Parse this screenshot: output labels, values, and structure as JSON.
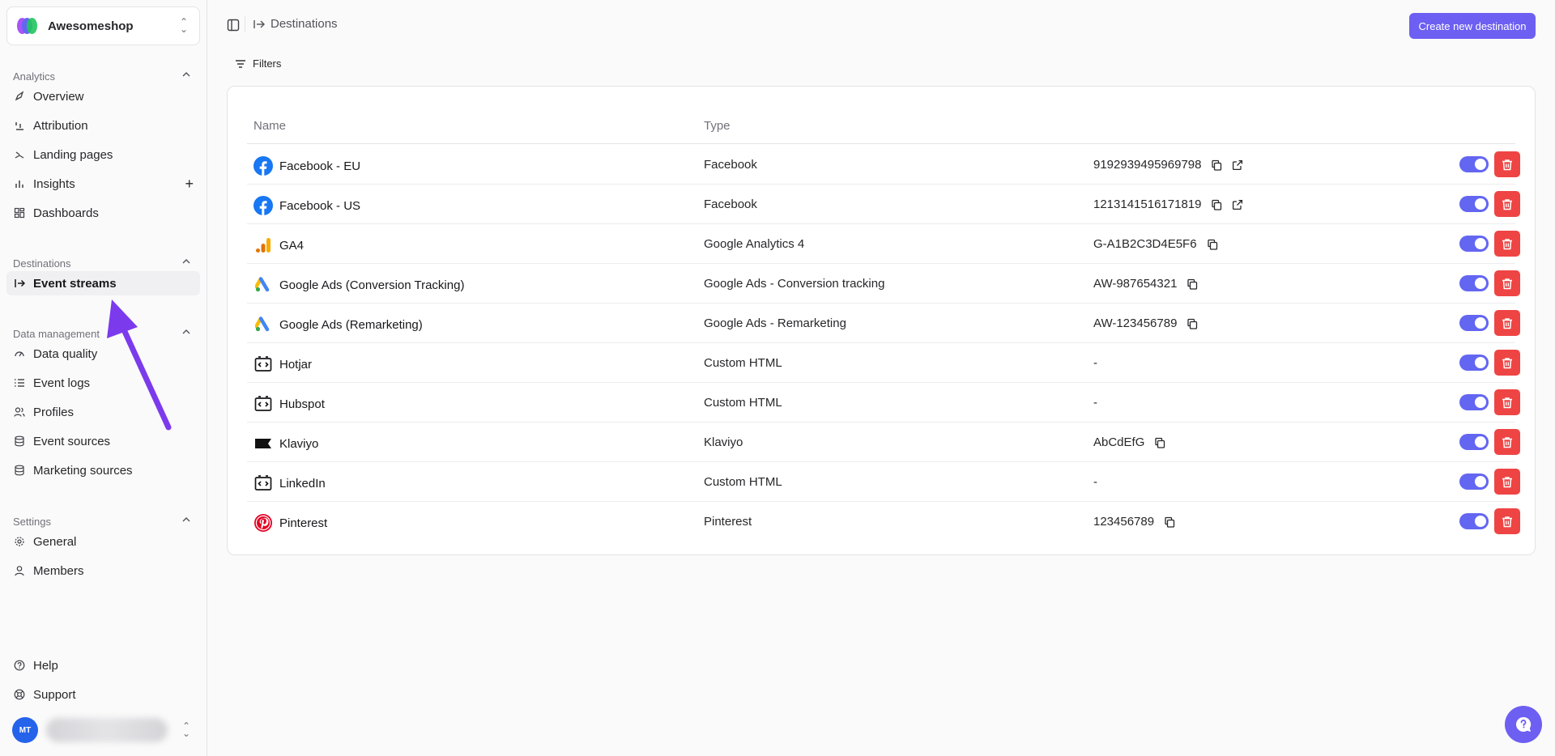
{
  "workspace": {
    "name": "Awesomeshop"
  },
  "sidebar": {
    "sections": [
      {
        "title": "Analytics",
        "items": [
          {
            "label": "Overview",
            "icon": "rocket-icon"
          },
          {
            "label": "Attribution",
            "icon": "attribution-icon"
          },
          {
            "label": "Landing pages",
            "icon": "landing-icon"
          },
          {
            "label": "Insights",
            "icon": "bar-chart-icon"
          },
          {
            "label": "Dashboards",
            "icon": "dashboard-icon"
          }
        ]
      },
      {
        "title": "Destinations",
        "items": [
          {
            "label": "Event streams",
            "icon": "arrow-right-from-line-icon",
            "active": true
          }
        ]
      },
      {
        "title": "Data management",
        "items": [
          {
            "label": "Data quality",
            "icon": "gauge-icon"
          },
          {
            "label": "Event logs",
            "icon": "list-icon"
          },
          {
            "label": "Profiles",
            "icon": "users-icon"
          },
          {
            "label": "Event sources",
            "icon": "database-icon"
          },
          {
            "label": "Marketing sources",
            "icon": "database-icon"
          }
        ]
      },
      {
        "title": "Settings",
        "items": [
          {
            "label": "General",
            "icon": "gear-icon"
          },
          {
            "label": "Members",
            "icon": "user-icon"
          }
        ]
      }
    ],
    "footer": [
      {
        "label": "Help",
        "icon": "help-circle-icon"
      },
      {
        "label": "Support",
        "icon": "life-buoy-icon"
      }
    ],
    "user": {
      "initials": "MT"
    }
  },
  "header": {
    "breadcrumb": "Destinations",
    "create_button": "Create new destination",
    "filters_label": "Filters"
  },
  "table": {
    "columns": [
      "Name",
      "Type"
    ],
    "rows": [
      {
        "name": "Facebook - EU",
        "type": "Facebook",
        "id": "9192939495969798",
        "logo": "facebook",
        "copy": true,
        "external": true,
        "enabled": true
      },
      {
        "name": "Facebook - US",
        "type": "Facebook",
        "id": "1213141516171819",
        "logo": "facebook",
        "copy": true,
        "external": true,
        "enabled": true
      },
      {
        "name": "GA4",
        "type": "Google Analytics 4",
        "id": "G-A1B2C3D4E5F6",
        "logo": "ga4",
        "copy": true,
        "external": false,
        "enabled": true
      },
      {
        "name": "Google Ads (Conversion Tracking)",
        "type": "Google Ads - Conversion tracking",
        "id": "AW-987654321",
        "logo": "google-ads",
        "copy": true,
        "external": false,
        "enabled": true
      },
      {
        "name": "Google Ads (Remarketing)",
        "type": "Google Ads - Remarketing",
        "id": "AW-123456789",
        "logo": "google-ads",
        "copy": true,
        "external": false,
        "enabled": true
      },
      {
        "name": "Hotjar",
        "type": "Custom HTML",
        "id": "-",
        "logo": "custom-html",
        "copy": false,
        "external": false,
        "enabled": true
      },
      {
        "name": "Hubspot",
        "type": "Custom HTML",
        "id": "-",
        "logo": "custom-html",
        "copy": false,
        "external": false,
        "enabled": true
      },
      {
        "name": "Klaviyo",
        "type": "Klaviyo",
        "id": "AbCdEfG",
        "logo": "klaviyo",
        "copy": true,
        "external": false,
        "enabled": true
      },
      {
        "name": "LinkedIn",
        "type": "Custom HTML",
        "id": "-",
        "logo": "custom-html",
        "copy": false,
        "external": false,
        "enabled": true
      },
      {
        "name": "Pinterest",
        "type": "Pinterest",
        "id": "123456789",
        "logo": "pinterest",
        "copy": true,
        "external": false,
        "enabled": true
      }
    ]
  },
  "colors": {
    "accent": "#6d5ff2",
    "toggle": "#6366f1",
    "danger": "#ef4444",
    "annotation_arrow": "#7c3aed"
  }
}
